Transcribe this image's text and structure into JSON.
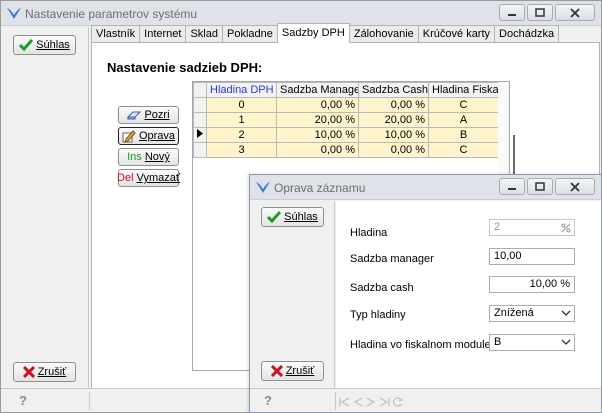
{
  "main_window": {
    "title": "Nastavenie parametrov systému",
    "confirm_label": "Súhlas",
    "cancel_label": "Zrušiť"
  },
  "tabs": [
    {
      "label": "Vlastník",
      "active": false
    },
    {
      "label": "Internet",
      "active": false
    },
    {
      "label": "Sklad",
      "active": false
    },
    {
      "label": "Pokladne",
      "active": false
    },
    {
      "label": "Sadzby DPH",
      "active": true
    },
    {
      "label": "Zálohovanie",
      "active": false
    },
    {
      "label": "Krúčové karty",
      "active": false
    },
    {
      "label": "Dochádzka",
      "active": false
    }
  ],
  "section_title": "Nastavenie sadzieb DPH:",
  "side_buttons": {
    "view": "Pozri",
    "edit": "Oprava",
    "new_prefix": "Ins",
    "new": "Nový",
    "delete_prefix": "Del",
    "delete": "Vymazať"
  },
  "vat_grid": {
    "columns": [
      "Hladina DPH",
      "Sadzba Manager",
      "Sadzba Cash",
      "Hladina Fiskal"
    ],
    "rows": [
      {
        "level": "0",
        "manager": "0,00 %",
        "cash": "0,00 %",
        "fiscal": "C",
        "current": false
      },
      {
        "level": "1",
        "manager": "20,00 %",
        "cash": "20,00 %",
        "fiscal": "A",
        "current": false
      },
      {
        "level": "2",
        "manager": "10,00 %",
        "cash": "10,00 %",
        "fiscal": "B",
        "current": true
      },
      {
        "level": "3",
        "manager": "0,00 %",
        "cash": "0,00 %",
        "fiscal": "C",
        "current": false
      }
    ]
  },
  "dialog": {
    "title": "Oprava záznamu",
    "confirm_label": "Súhlas",
    "cancel_label": "Zrušiť",
    "fields": {
      "level_label": "Hladina",
      "level_value": "2",
      "manager_label": "Sadzba manager",
      "manager_value": "10,00",
      "cash_label": "Sadzba cash",
      "cash_value": "10,00 %",
      "type_label": "Typ hladiny",
      "type_value": "Znížená",
      "fiscal_label": "Hladina vo fiskalnom module",
      "fiscal_value": "B"
    }
  },
  "status_help": "?",
  "colors": {
    "grid_row_bg": "#fff4cc",
    "header_blue": "#2a3bd8",
    "ok_check": "#1d9a2e",
    "cancel_x": "#c8141e"
  }
}
